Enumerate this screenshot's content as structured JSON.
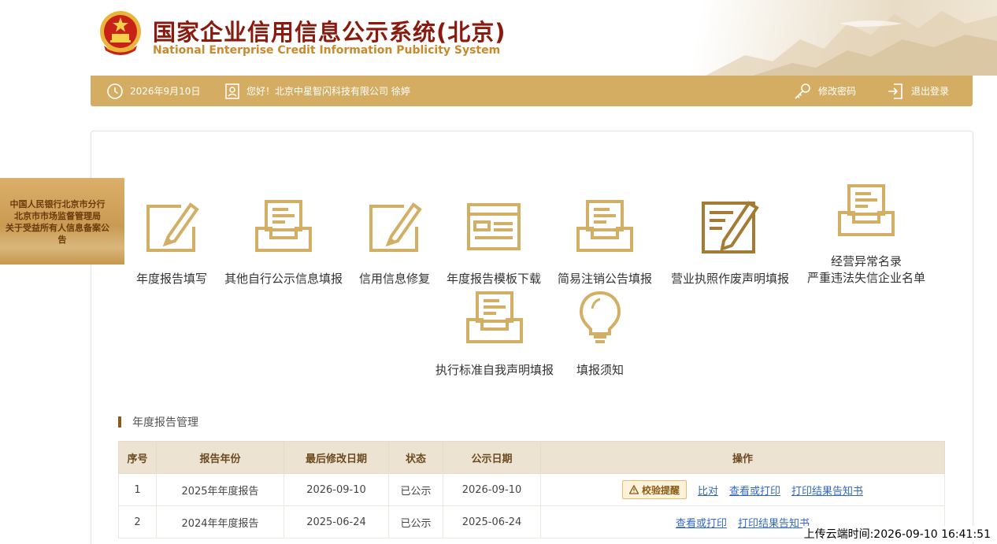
{
  "header": {
    "title_cn": "国家企业信用信息公示系统(北京)",
    "title_en": "National Enterprise Credit Information Publicity System"
  },
  "topbar": {
    "date": "2026年9月10日",
    "greeting": "您好！北京中星智闪科技有限公司  徐婷",
    "change_password": "修改密码",
    "logout": "退出登录",
    "bar_color": "#d4ad62"
  },
  "notice": {
    "lines": [
      "中国人民银行北京市分行",
      "北京市市场监督管理局",
      "关于受益所有人信息备案公",
      "告"
    ]
  },
  "tiles": [
    {
      "label": "年度报告填写",
      "icon": "edit-pen-icon"
    },
    {
      "label": "其他自行公示信息填报",
      "icon": "inbox-document-icon"
    },
    {
      "label": "信用信息修复",
      "icon": "edit-pen-icon"
    },
    {
      "label": "年度报告模板下载",
      "icon": "template-window-icon"
    },
    {
      "label": "简易注销公告填报",
      "icon": "inbox-document-icon"
    },
    {
      "label": "营业执照作废声明填报",
      "icon": "license-edit-icon"
    },
    {
      "label": "经营异常名录",
      "label2": "严重违法失信企业名单",
      "icon": "inbox-document-icon"
    },
    {
      "label": "执行标准自我声明填报",
      "icon": "inbox-document-icon"
    },
    {
      "label": "填报须知",
      "icon": "lightbulb-icon"
    }
  ],
  "section": {
    "title": "年度报告管理"
  },
  "table": {
    "headers": [
      "序号",
      "报告年份",
      "最后修改日期",
      "状态",
      "公示日期",
      "操作"
    ],
    "rows": [
      {
        "no": "1",
        "year": "2025年年度报告",
        "modified": "2026-09-10",
        "status": "已公示",
        "published": "2026-09-10",
        "warn": "校验提醒",
        "ops": [
          "比对",
          "查看或打印",
          "打印结果告知书"
        ]
      },
      {
        "no": "2",
        "year": "2024年年度报告",
        "modified": "2025-06-24",
        "status": "已公示",
        "published": "2025-06-24",
        "ops": [
          "查看或打印",
          "打印结果告知书"
        ]
      }
    ]
  },
  "upload_time": "上传云端时间:2026-09-10 16:41:51",
  "colors": {
    "gold": "#c9a45a",
    "icon_gold": "#d3ae65",
    "brown": "#8b5a1f",
    "link": "#3468c8"
  }
}
